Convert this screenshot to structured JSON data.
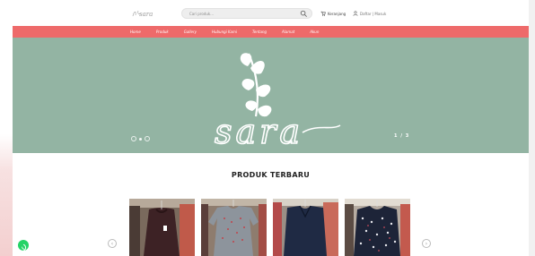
{
  "header": {
    "logo_text": "sara",
    "search_placeholder": "Cari produk...",
    "cart_label": "Keranjang",
    "account_label": "Daftar | Masuk"
  },
  "nav": {
    "items": [
      "Home",
      "Produk",
      "Gallery",
      "Hubungi Kami",
      "Tentang",
      "Alamat",
      "Akun"
    ]
  },
  "hero": {
    "brand": "sara",
    "slide_counter": "1 / 3"
  },
  "section": {
    "title": "PRODUK TERBARU"
  },
  "products": [
    {
      "icon": "product-photo-dark-maroon-dress"
    },
    {
      "icon": "product-photo-grey-dress"
    },
    {
      "icon": "product-photo-navy-dress"
    },
    {
      "icon": "product-photo-navy-floral-dress"
    }
  ],
  "colors": {
    "accent": "#ee6a6a",
    "hero_bg": "#93b4a3",
    "whatsapp": "#25d366"
  }
}
